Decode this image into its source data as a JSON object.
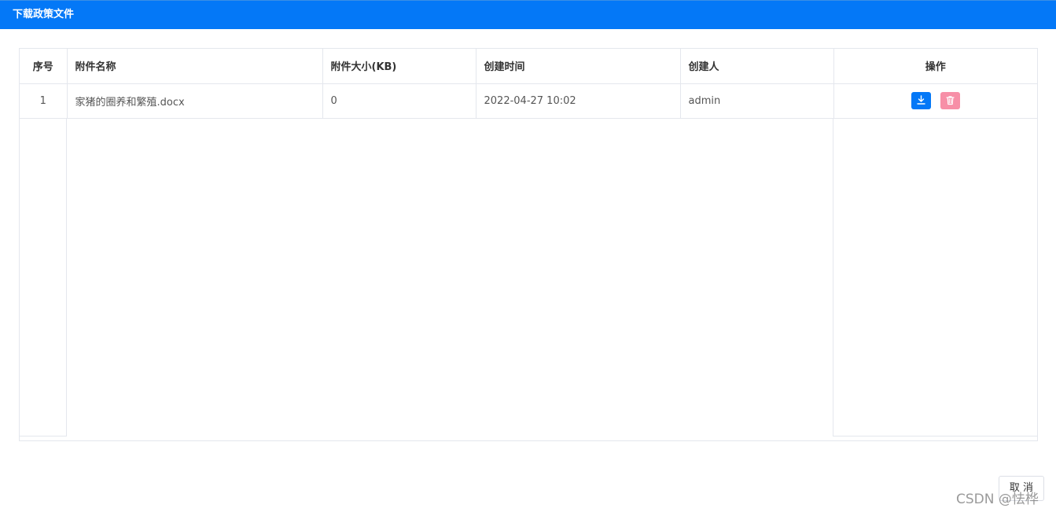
{
  "header": {
    "title": "下载政策文件"
  },
  "table": {
    "columns": [
      "序号",
      "附件名称",
      "附件大小(KB)",
      "创建时间",
      "创建人",
      "操作"
    ],
    "rows": [
      {
        "index": "1",
        "name": "家猪的圈养和繁殖.docx",
        "size": "0",
        "created_at": "2022-04-27 10:02",
        "creator": "admin"
      }
    ]
  },
  "actions": {
    "download_icon": "download-icon",
    "delete_icon": "trash-icon"
  },
  "footer": {
    "cancel_label": "取 消"
  },
  "watermark": {
    "text": "CSDN @怯桦"
  },
  "colors": {
    "primary": "#0478f7",
    "danger_light": "#f78fa7",
    "border": "#e4e7ed"
  }
}
